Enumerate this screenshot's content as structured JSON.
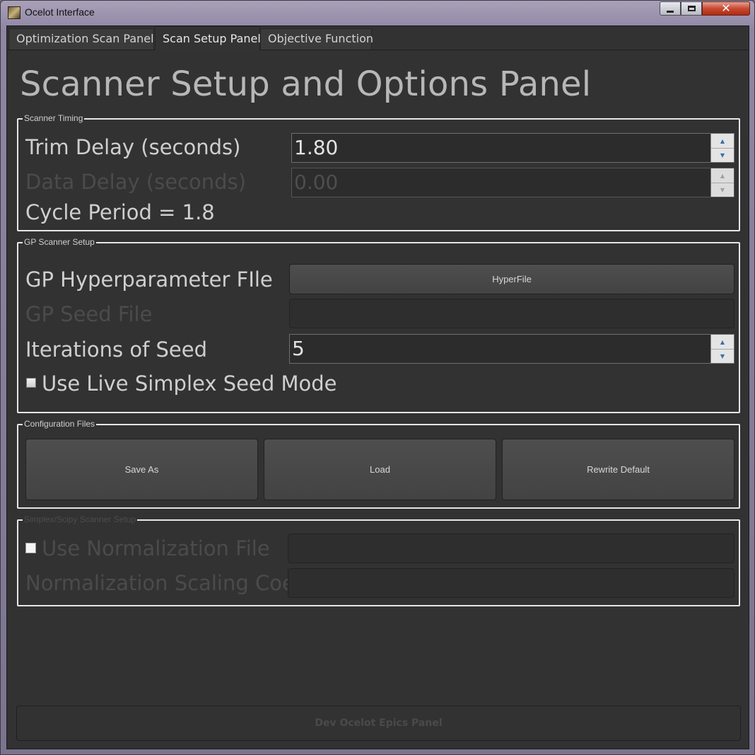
{
  "window": {
    "title": "Ocelot Interface",
    "close_glyph": "✕"
  },
  "tabs": [
    {
      "label": "Optimization Scan Panel"
    },
    {
      "label": "Scan Setup Panel"
    },
    {
      "label": "Objective Function"
    }
  ],
  "page": {
    "title": "Scanner Setup and Options Panel"
  },
  "scanner_timing": {
    "group_title": "Scanner Timing",
    "trim_delay_label": "Trim Delay (seconds)",
    "trim_delay_value": "1.80",
    "data_delay_label": "Data Delay (seconds)",
    "data_delay_value": "0.00",
    "cycle_period_text": "Cycle Period = 1.8"
  },
  "gp_setup": {
    "group_title": "GP Scanner Setup",
    "hyperparameter_label": "GP Hyperparameter FIle",
    "hyperfile_button": "HyperFile",
    "seed_file_label": "GP Seed File",
    "iterations_label": "Iterations of Seed",
    "iterations_value": "5",
    "live_simplex_label": "Use Live Simplex Seed Mode",
    "live_simplex_checked": false
  },
  "config_files": {
    "group_title": "Configuration Files",
    "save_as": "Save As",
    "load": "Load",
    "rewrite_default": "Rewrite Default"
  },
  "simplex_setup": {
    "group_title": "Simplex/Scipy Scanner Setup",
    "use_normalization_label": "Use Normalization File",
    "normalization_checked": false,
    "scaling_coeff_label": "Normalization Scaling Coeff"
  },
  "footer": {
    "dev_epics_button": "Dev Ocelot Epics Panel"
  },
  "colors": {
    "background": "#323232",
    "text": "#cfcfcf",
    "disabled_text": "#4b4b4b",
    "group_border": "#e6e6e6"
  }
}
